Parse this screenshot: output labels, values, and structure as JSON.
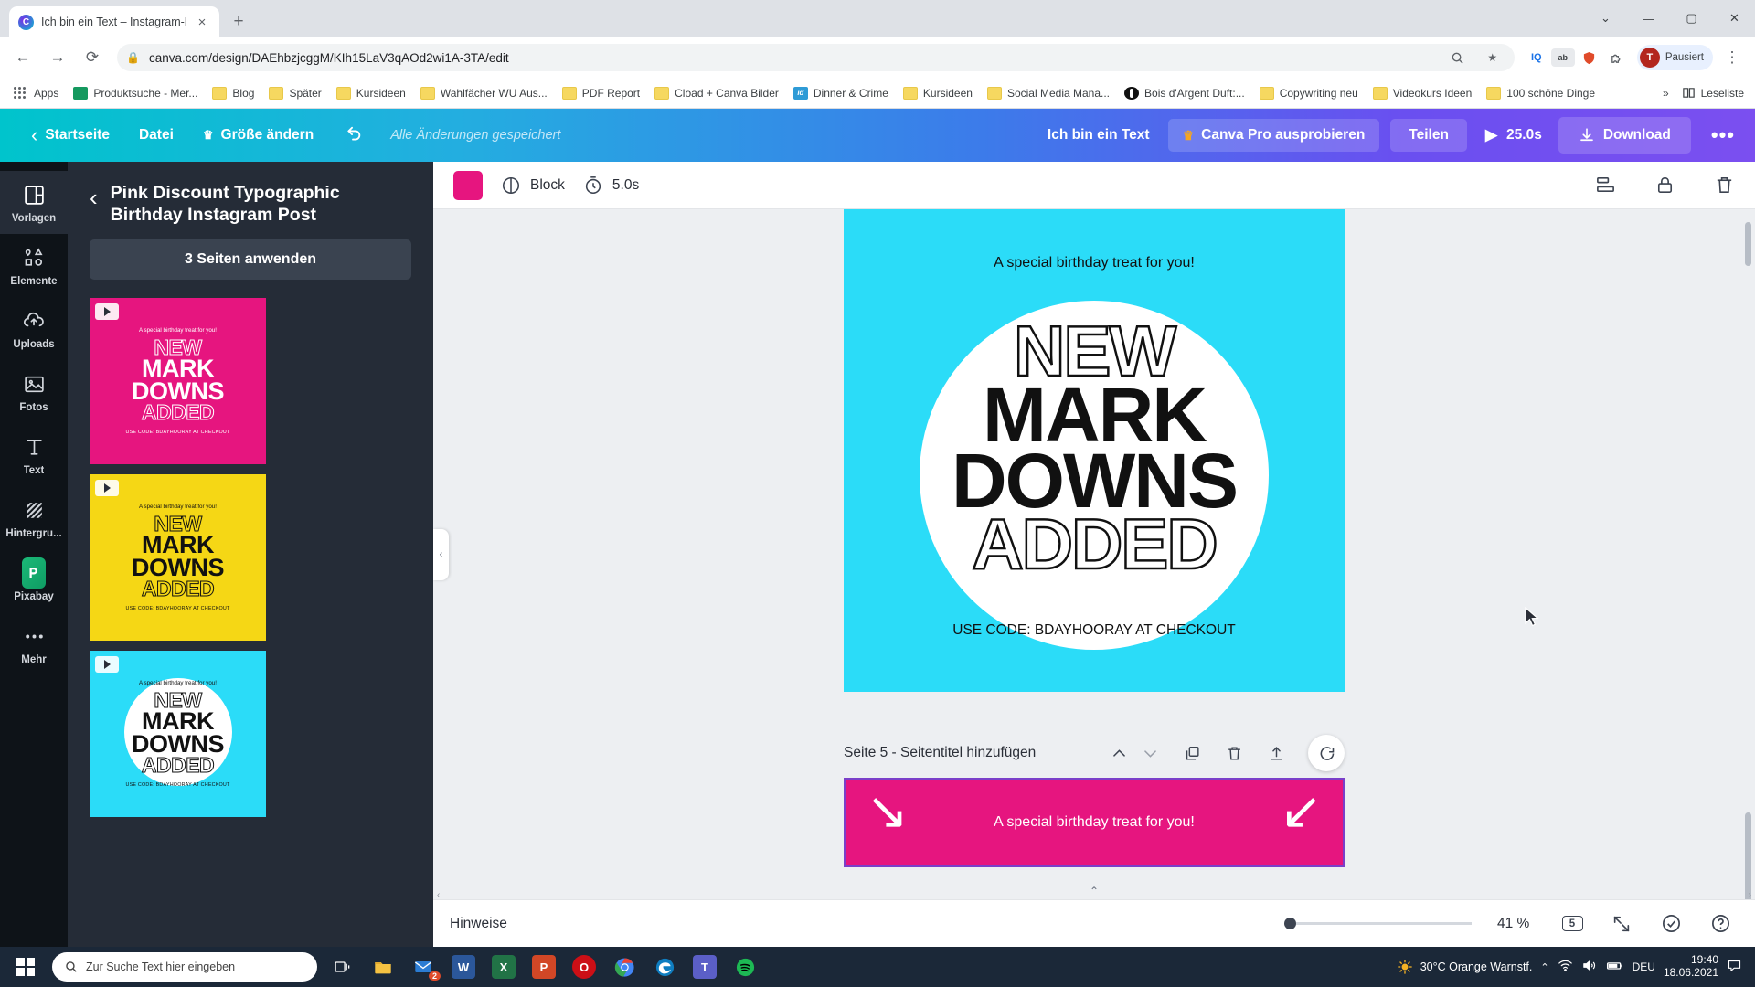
{
  "browser": {
    "tab": {
      "title": "Ich bin ein Text – Instagram-Beitr",
      "favicon": "canva-icon",
      "close": "×"
    },
    "newtab_label": "+",
    "window_controls": {
      "minimize": "—",
      "maximize": "▢",
      "close": "✕",
      "extra": "⌄"
    },
    "nav": {
      "back": "←",
      "forward": "→",
      "reload": "⟳"
    },
    "omnibox": {
      "lock_icon": "lock-icon",
      "url": "canva.com/design/DAEhbzjcggM/KIh15LaV3qAOd2wi1A-3TA/edit",
      "zoom_icon": "zoom-indicator-icon",
      "star_icon": "★"
    },
    "extensions": [
      {
        "name": "iq-extension",
        "label": "IQ"
      },
      {
        "name": "color-picker-extension",
        "label": "◉"
      },
      {
        "name": "shield-extension",
        "label": "⛊"
      },
      {
        "name": "puzzle-extension",
        "label": "🧩"
      }
    ],
    "profile": {
      "avatar_letter": "T",
      "label": "Pausiert"
    },
    "menu_icon": "⋮",
    "bookmarks": [
      {
        "label": "Apps",
        "icon": "apps-grid-icon"
      },
      {
        "label": "Produktsuche - Mer...",
        "icon": "green-square-icon"
      },
      {
        "label": "Blog",
        "icon": "folder-icon"
      },
      {
        "label": "Später",
        "icon": "folder-icon"
      },
      {
        "label": "Kursideen",
        "icon": "folder-icon"
      },
      {
        "label": "Wahlfächer WU Aus...",
        "icon": "folder-icon"
      },
      {
        "label": "PDF Report",
        "icon": "folder-icon"
      },
      {
        "label": "Cload + Canva Bilder",
        "icon": "folder-icon"
      },
      {
        "label": "Dinner & Crime",
        "icon": "id-icon"
      },
      {
        "label": "Kursideen",
        "icon": "folder-icon"
      },
      {
        "label": "Social Media Mana...",
        "icon": "folder-icon"
      },
      {
        "label": "Bois d'Argent Duft:...",
        "icon": "contrast-circle-icon"
      },
      {
        "label": "Copywriting neu",
        "icon": "folder-icon"
      },
      {
        "label": "Videokurs Ideen",
        "icon": "folder-icon"
      },
      {
        "label": "100 schöne Dinge",
        "icon": "folder-icon"
      }
    ],
    "bookmarks_overflow": "»",
    "reading_list": {
      "label": "Leseliste",
      "icon": "reading-list-icon"
    }
  },
  "canva_toolbar": {
    "back_chevron": "‹",
    "home": "Startseite",
    "file": "Datei",
    "resize": "Größe ändern",
    "resize_crown": "♛",
    "undo_icon": "undo-icon",
    "saved_status": "Alle Änderungen gespeichert",
    "text_title": "Ich bin ein Text",
    "pro_label": "Canva Pro ausprobieren",
    "pro_crown": "♛",
    "share": "Teilen",
    "play_icon": "▶",
    "duration": "25.0s",
    "download": "Download",
    "download_icon": "download-icon",
    "more": "•••"
  },
  "sidebar": {
    "items": [
      {
        "label": "Vorlagen",
        "icon": "templates-icon",
        "active": true
      },
      {
        "label": "Elemente",
        "icon": "elements-icon",
        "active": false
      },
      {
        "label": "Uploads",
        "icon": "upload-cloud-icon",
        "active": false
      },
      {
        "label": "Fotos",
        "icon": "photo-icon",
        "active": false
      },
      {
        "label": "Text",
        "icon": "text-icon",
        "active": false
      },
      {
        "label": "Hintergru...",
        "icon": "background-hatch-icon",
        "active": false
      },
      {
        "label": "Pixabay",
        "icon": "pixabay-icon",
        "active": false
      },
      {
        "label": "Mehr",
        "icon": "more-dots-icon",
        "active": false
      }
    ]
  },
  "panel": {
    "back_chevron": "‹",
    "title": "Pink Discount Typographic Birthday Instagram Post",
    "apply_button": "3 Seiten anwenden",
    "thumbnails": [
      {
        "name": "template-thumb-pink",
        "bg": "#e6157f",
        "line1": "NEW",
        "line2": "MARK",
        "line3": "DOWNS",
        "line4": "ADDED",
        "top": "A special birthday treat for you!",
        "code": "USE CODE: BDAYHOORAY AT CHECKOUT",
        "textColor": "#ffffff",
        "video": true
      },
      {
        "name": "template-thumb-yellow",
        "bg": "#f5d715",
        "line1": "NEW",
        "line2": "MARK",
        "line3": "DOWNS",
        "line4": "ADDED",
        "top": "A special birthday treat for you!",
        "code": "USE CODE: BDAYHOORAY AT CHECKOUT",
        "textColor": "#111111",
        "video": true
      },
      {
        "name": "template-thumb-cyan",
        "bg": "#2bdcf8",
        "line1": "NEW",
        "line2": "MARK",
        "line3": "DOWNS",
        "line4": "ADDED",
        "top": "A special birthday treat for you!",
        "code": "USE CODE: BDAYHOORAY AT CHECKOUT",
        "textColor": "#111111",
        "video": true
      }
    ]
  },
  "editor_toolbar": {
    "color_swatch": "#e6157f",
    "block_label": "Block",
    "block_icon": "block-shape-icon",
    "timer_icon": "timer-icon",
    "duration": "5.0s",
    "position_icon": "position-icon",
    "lock_icon": "lock-icon",
    "delete_icon": "trash-icon"
  },
  "canvas": {
    "current_page": {
      "bg": "#2bdcf8",
      "top_text": "A special birthday treat for you!",
      "line1": "NEW",
      "line2": "MARK",
      "line3": "DOWNS",
      "line4": "ADDED",
      "code_text": "USE CODE: BDAYHOORAY AT CHECKOUT"
    },
    "page_label": "Seite 5 - Seitentitel hinzufügen",
    "page_actions": [
      {
        "name": "move-up-icon",
        "glyph": "⌃"
      },
      {
        "name": "move-down-icon",
        "glyph": "⌄"
      },
      {
        "name": "duplicate-page-icon",
        "glyph": "❐"
      },
      {
        "name": "delete-page-icon",
        "glyph": "🗑"
      },
      {
        "name": "add-page-icon",
        "glyph": "⬆"
      },
      {
        "name": "comment-icon",
        "glyph": "💬"
      }
    ],
    "next_page": {
      "bg": "#e6157f",
      "text": "A special birthday treat for you!"
    }
  },
  "statusbar": {
    "notes_label": "Hinweise",
    "zoom_value": "41 %",
    "page_count": "5",
    "fullscreen_icon": "expand-icon",
    "check_icon": "check-circle-icon",
    "help_icon": "help-circle-icon"
  },
  "taskbar": {
    "start_icon": "windows-start-icon",
    "search_placeholder": "Zur Suche Text hier eingeben",
    "search_icon": "search-icon",
    "apps": [
      {
        "name": "task-view-icon",
        "glyph": "❐",
        "color": "#ffffff"
      },
      {
        "name": "file-explorer-icon",
        "glyph": "📁",
        "color": "#f5c242"
      },
      {
        "name": "mail-icon",
        "glyph": "✉",
        "color": "#2b7cd3",
        "badge": "2"
      },
      {
        "name": "word-icon",
        "glyph": "W",
        "color": "#2b579a"
      },
      {
        "name": "excel-icon",
        "glyph": "X",
        "color": "#217346"
      },
      {
        "name": "powerpoint-icon",
        "glyph": "P",
        "color": "#d24726"
      },
      {
        "name": "opera-icon",
        "glyph": "O",
        "color": "#cc0f16"
      },
      {
        "name": "chrome-icon",
        "glyph": "◉",
        "color": "#4285f4"
      },
      {
        "name": "edge-icon",
        "glyph": "e",
        "color": "#0f7ec1"
      },
      {
        "name": "teams-icon",
        "glyph": "T",
        "color": "#5b5fc7"
      },
      {
        "name": "spotify-icon",
        "glyph": "♫",
        "color": "#1db954"
      }
    ],
    "tray": {
      "weather_icon": "sun-icon",
      "weather": "30°C  Orange Warnstf.",
      "chevron": "⌃",
      "network_icon": "wifi-icon",
      "volume_icon": "speaker-icon",
      "battery_icon": "battery-icon",
      "language": "DEU",
      "time": "19:40",
      "date": "18.06.2021",
      "notification_icon": "notification-icon"
    }
  }
}
